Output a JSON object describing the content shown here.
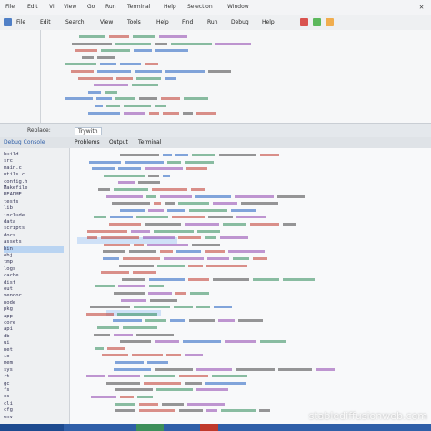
{
  "menubar": {
    "items": [
      "File",
      "Edit",
      "Vi",
      "View",
      "Go",
      "Run",
      "Terminal",
      "Help",
      "Selection",
      "Window"
    ],
    "close_glyph": "✕"
  },
  "toolbar": {
    "tabs": [
      "File",
      "Edit",
      "Search",
      "View",
      "Tools",
      "Help",
      "Find",
      "Run",
      "Debug",
      "Help"
    ]
  },
  "find": {
    "label": "Replace:",
    "value": "Trywith"
  },
  "panel": {
    "title": "Debug Console",
    "tabs": [
      "Problems",
      "Output",
      "Terminal"
    ]
  },
  "sidebar": {
    "items": [
      "build",
      "src",
      "main.c",
      "utils.c",
      "config.h",
      "Makefile",
      "README",
      "tests",
      "lib",
      "include",
      "data",
      "scripts",
      "docs",
      "assets",
      "bin",
      "obj",
      "tmp",
      "logs",
      "cache",
      "dist",
      "out",
      "vendor",
      "node",
      "pkg",
      "app",
      "core",
      "api",
      "db",
      "ui",
      "net",
      "io",
      "mem",
      "sys",
      "rt",
      "gc",
      "fs",
      "os",
      "cli",
      "cfg",
      "env"
    ],
    "selected_index": 14
  },
  "colors": {
    "accent": "#2f5fa8",
    "keyword": "#1f5fbf",
    "string": "#c0392b",
    "comment": "#2e8b57",
    "number": "#8e44ad",
    "highlight": "#cfe1f7"
  },
  "watermark": "stablediffusionweb.com"
}
